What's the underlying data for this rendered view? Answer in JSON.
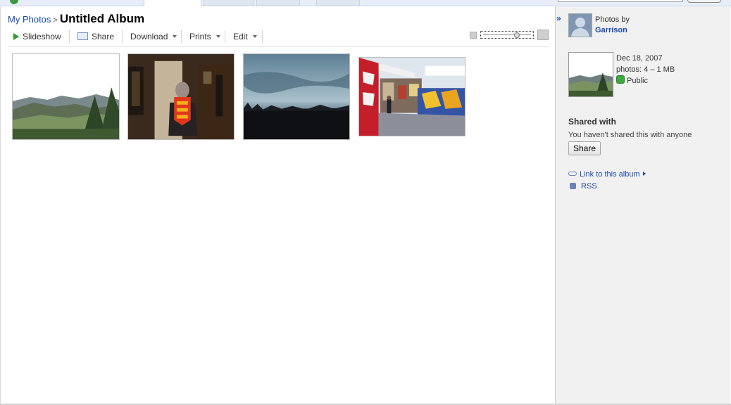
{
  "breadcrumb": {
    "parent": "My Photos",
    "separator": ">",
    "title": "Untitled Album"
  },
  "toolbar": {
    "slideshow": "Slideshow",
    "share": "Share",
    "download": "Download",
    "prints": "Prints",
    "edit": "Edit"
  },
  "zoom": {
    "level": 0.75
  },
  "photos": [
    {
      "name": "photo-1",
      "subject": "hillside landscape"
    },
    {
      "name": "photo-2",
      "subject": "person indoors"
    },
    {
      "name": "photo-3",
      "subject": "dusk sky"
    },
    {
      "name": "photo-4",
      "subject": "graffiti wall"
    }
  ],
  "sidebar": {
    "photos_by": "Photos by",
    "owner": "Garrison",
    "date": "Dec 18, 2007",
    "count": "photos: 4 – 1 MB",
    "visibility": "Public",
    "shared_heading": "Shared with",
    "shared_text": "You haven't shared this with anyone",
    "share_button": "Share",
    "link_label": "Link to this album",
    "rss_label": "RSS",
    "collapse": "»"
  },
  "colors": {
    "link": "#1a47b0",
    "sidebar_bg": "#f1f1f1",
    "play": "#2e9b2e"
  }
}
